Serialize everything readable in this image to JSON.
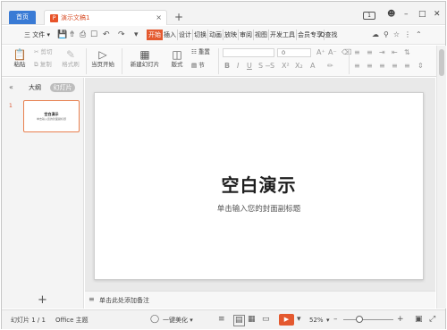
{
  "titlebar": {
    "home_tab": "首页",
    "doc_tab": "演示文稿1",
    "close_glyph": "×",
    "add_glyph": "+",
    "badge": "1",
    "minimize": "–",
    "maximize": "□",
    "close": "✕"
  },
  "menubar": {
    "file": "三 文件 ▾",
    "tabs": [
      "开始",
      "插入",
      "设计",
      "切换",
      "动画",
      "放映",
      "审阅",
      "视图",
      "开发工具",
      "会员专享"
    ],
    "active_tab": "开始",
    "search": "Q查找"
  },
  "ribbon": {
    "paste": "粘贴",
    "cut": "剪切",
    "copy": "复制",
    "format_painter": "格式刷",
    "from_current": "当页开始",
    "new_slide": "新建幻灯片",
    "layout": "版式",
    "section": "节",
    "reset": "重置",
    "font_size": "0"
  },
  "left_panel": {
    "outline_tab": "大纲",
    "slides_tab": "幻灯片",
    "slide_number": "1",
    "thumb_title": "空白演示",
    "thumb_subtitle": "单击输入您的封面副标题",
    "add_glyph": "+"
  },
  "slide": {
    "title": "空白演示",
    "subtitle": "单击输入您的封面副标题"
  },
  "notes": {
    "placeholder": "单击此处添加备注"
  },
  "statusbar": {
    "slide_count": "幻灯片 1 / 1",
    "theme": "Office 主题",
    "beautify": "一键美化 ▾",
    "zoom": "52%",
    "zoom_level": 0.52
  },
  "colors": {
    "accent": "#e4592f",
    "home_tab": "#3a7bd5"
  }
}
